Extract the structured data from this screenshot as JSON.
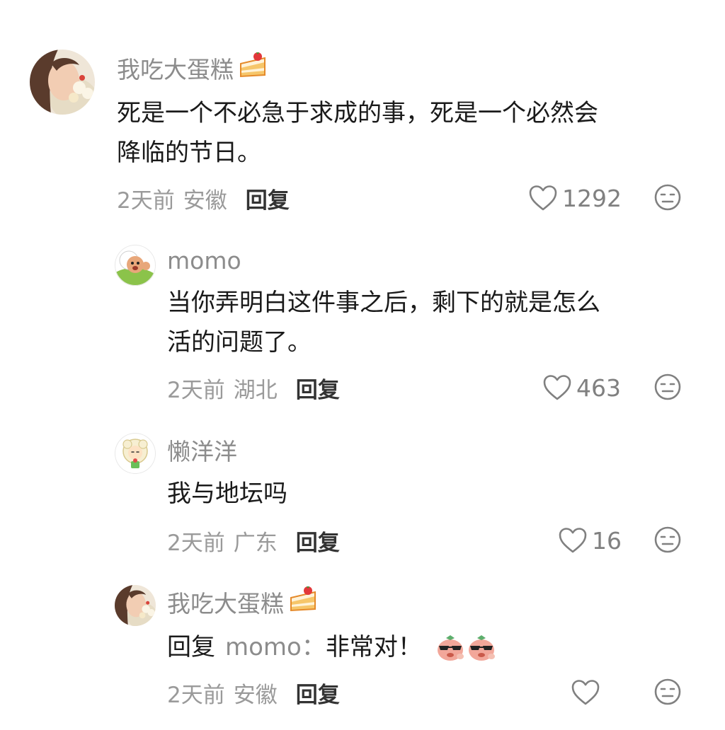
{
  "comments": [
    {
      "username": "我吃大蛋糕",
      "username_emoji": "cake-emoji",
      "text_line1": "死是一个不必急于求成的事，死是一个必然会",
      "text_line2": "降临的节日。",
      "time": "2天前",
      "location": "安徽",
      "reply_label": "回复",
      "likes": "1292"
    },
    {
      "username": "momo",
      "text_line1": "当你弄明白这件事之后，剩下的就是怎么",
      "text_line2": "活的问题了。",
      "time": "2天前",
      "location": "湖北",
      "reply_label": "回复",
      "likes": "463"
    },
    {
      "username": "懒洋洋",
      "text_line1": "我与地坛吗",
      "time": "2天前",
      "location": "广东",
      "reply_label": "回复",
      "likes": "16"
    },
    {
      "username": "我吃大蛋糕",
      "username_emoji": "cake-emoji",
      "reply_prefix": "回复",
      "reply_target": "momo：",
      "text_line1": "非常对！",
      "inline_emojis": [
        "sunglasses-sticker-emoji",
        "sunglasses-sticker-emoji"
      ],
      "time": "2天前",
      "location": "安徽",
      "reply_label": "回复",
      "likes": ""
    }
  ],
  "colors": {
    "username": "#8c8c8c",
    "text": "#1a1a1a",
    "meta": "#9a9a9a",
    "reply": "#333333",
    "icon": "#808080"
  },
  "icons": [
    "heart-outline-icon",
    "dislike-face-icon"
  ]
}
